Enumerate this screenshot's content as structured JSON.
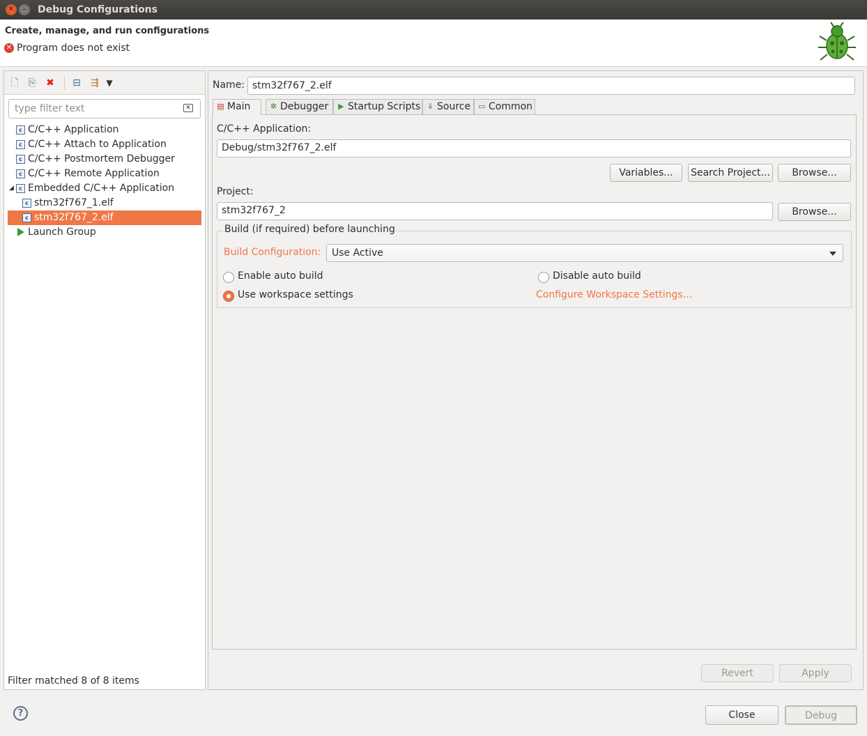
{
  "window": {
    "title": "Debug Configurations"
  },
  "header": {
    "title": "Create, manage, and run configurations",
    "message": "Program does not exist",
    "message_icon": "error-icon",
    "logo_icon": "bug-icon"
  },
  "left": {
    "toolbar": [
      {
        "name": "new-configuration-icon",
        "glyph": "🗋"
      },
      {
        "name": "duplicate-configuration-icon",
        "glyph": "⎘"
      },
      {
        "name": "delete-configuration-icon",
        "glyph": "✖"
      },
      {
        "name": "collapse-all-icon",
        "glyph": "⊟"
      },
      {
        "name": "filter-configurations-icon",
        "glyph": "⇶"
      },
      {
        "name": "view-menu-chevron-down-icon",
        "glyph": "▾"
      }
    ],
    "filter_placeholder": "type filter text",
    "tree": [
      {
        "label": "C/C++ Application",
        "icon": "c-config-icon",
        "level": 0
      },
      {
        "label": "C/C++ Attach to Application",
        "icon": "c-config-icon",
        "level": 0
      },
      {
        "label": "C/C++ Postmortem Debugger",
        "icon": "c-config-icon",
        "level": 0
      },
      {
        "label": "C/C++ Remote Application",
        "icon": "c-config-icon",
        "level": 0
      },
      {
        "label": "Embedded C/C++ Application",
        "icon": "c-config-icon",
        "level": 0,
        "expanded": true
      },
      {
        "label": "stm32f767_1.elf",
        "icon": "c-config-icon",
        "level": 1
      },
      {
        "label": "stm32f767_2.elf",
        "icon": "c-config-icon",
        "level": 1,
        "selected": true
      },
      {
        "label": "Launch Group",
        "icon": "launch-group-icon",
        "level": 0
      }
    ],
    "filter_status": "Filter matched 8 of 8 items"
  },
  "right": {
    "name_label": "Name:",
    "name_value": "stm32f767_2.elf",
    "tabs": [
      {
        "label": "Main",
        "icon": "main-tab-icon",
        "active": true
      },
      {
        "label": "Debugger",
        "icon": "debugger-tab-icon"
      },
      {
        "label": "Startup Scripts",
        "icon": "startup-scripts-tab-icon"
      },
      {
        "label": "Source",
        "icon": "source-tab-icon"
      },
      {
        "label": "Common",
        "icon": "common-tab-icon"
      }
    ],
    "main": {
      "app_label": "C/C++ Application:",
      "app_value": "Debug/stm32f767_2.elf",
      "variables_button": "Variables...",
      "search_project_button": "Search Project...",
      "browse_button": "Browse...",
      "project_label": "Project:",
      "project_value": "stm32f767_2",
      "project_browse_button": "Browse...",
      "build_group_label": "Build (if required) before launching",
      "build_config_label": "Build Configuration:",
      "build_config_value": "Use Active",
      "enable_auto_build": "Enable auto build",
      "disable_auto_build": "Disable auto build",
      "use_workspace_settings": "Use workspace settings",
      "configure_workspace_link": "Configure Workspace Settings...",
      "selected_radio": "use_workspace_settings"
    },
    "revert_button": "Revert",
    "apply_button": "Apply"
  },
  "footer": {
    "help_icon": "help-icon",
    "close_button": "Close",
    "debug_button": "Debug"
  },
  "colors": {
    "accent": "#f07746",
    "titlebar": "#3c3b37",
    "background": "#f2f1f0",
    "error": "#e0402f"
  }
}
